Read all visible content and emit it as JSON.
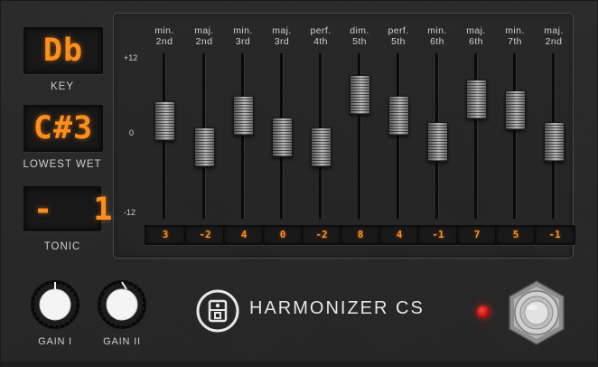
{
  "displays": {
    "key": {
      "value": "Db",
      "label": "KEY"
    },
    "lowest_wet": {
      "value": "C#3",
      "label": "LOWEST WET"
    },
    "tonic": {
      "value": "-  1",
      "label": "TONIC"
    }
  },
  "scale": {
    "top": "+12",
    "mid": "0",
    "bottom": "-12",
    "min": -12,
    "max": 12
  },
  "intervals": [
    {
      "quality": "min.",
      "name": "2nd",
      "value": 3
    },
    {
      "quality": "maj.",
      "name": "2nd",
      "value": -2
    },
    {
      "quality": "min.",
      "name": "3rd",
      "value": 4
    },
    {
      "quality": "maj.",
      "name": "3rd",
      "value": 0
    },
    {
      "quality": "perf.",
      "name": "4th",
      "value": -2
    },
    {
      "quality": "dim.",
      "name": "5th",
      "value": 8
    },
    {
      "quality": "perf.",
      "name": "5th",
      "value": 4
    },
    {
      "quality": "min.",
      "name": "6th",
      "value": -1
    },
    {
      "quality": "maj.",
      "name": "6th",
      "value": 7
    },
    {
      "quality": "min.",
      "name": "7th",
      "value": 5
    },
    {
      "quality": "maj.",
      "name": "2nd",
      "value": -1
    }
  ],
  "knobs": {
    "gain1": {
      "label": "GAIN I"
    },
    "gain2": {
      "label": "GAIN II"
    }
  },
  "product": {
    "title": "HARMONIZER CS"
  },
  "colors": {
    "display": "#ff8f1c",
    "led": "#e02a1a"
  },
  "icons": {
    "logo": "logo-icon",
    "led": "status-led",
    "footswitch": "footswitch-icon"
  }
}
